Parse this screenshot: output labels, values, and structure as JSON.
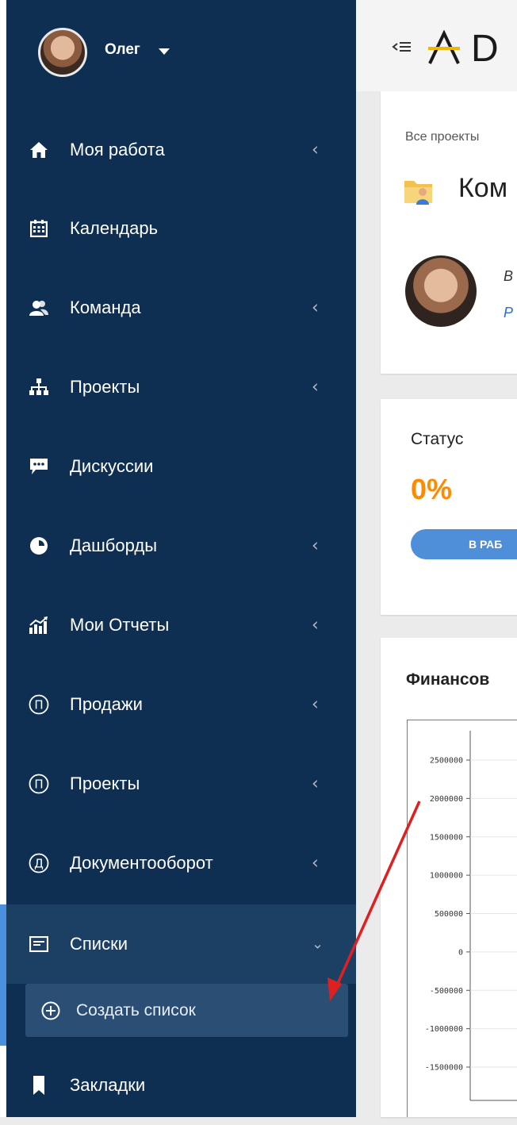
{
  "user": {
    "name": "Олег"
  },
  "sidebar": {
    "items": [
      {
        "label": "Моя работа",
        "icon": "home-icon",
        "has_chevron": true
      },
      {
        "label": "Календарь",
        "icon": "calendar-icon",
        "has_chevron": false
      },
      {
        "label": "Команда",
        "icon": "team-icon",
        "has_chevron": true
      },
      {
        "label": "Проекты",
        "icon": "sitemap-icon",
        "has_chevron": true
      },
      {
        "label": "Дискуссии",
        "icon": "comments-icon",
        "has_chevron": false
      },
      {
        "label": "Дашборды",
        "icon": "pie-chart-icon",
        "has_chevron": true
      },
      {
        "label": "Мои Отчеты",
        "icon": "bar-chart-icon",
        "has_chevron": true
      },
      {
        "label": "Продажи",
        "icon": "circle-letter-icon",
        "letter": "П",
        "has_chevron": true
      },
      {
        "label": "Проекты",
        "icon": "circle-letter-icon",
        "letter": "П",
        "has_chevron": true
      },
      {
        "label": "Документооборот",
        "icon": "circle-letter-icon",
        "letter": "Д",
        "has_chevron": true
      },
      {
        "label": "Списки",
        "icon": "list-icon",
        "has_chevron": true,
        "expanded": true,
        "active": true
      },
      {
        "label": "Закладки",
        "icon": "bookmark-icon",
        "has_chevron": false
      }
    ],
    "sub_item": {
      "label": "Создать список",
      "icon": "plus-circle-icon"
    }
  },
  "header": {
    "logo_letter": "D"
  },
  "project": {
    "breadcrumb": "Все проекты",
    "title": "Ком",
    "pm_line1": "В",
    "pm_line2": "Р"
  },
  "status": {
    "label": "Статус",
    "percent": "0%",
    "pill": "В РАБ"
  },
  "finance": {
    "title": "Финансов"
  },
  "chart_data": {
    "type": "line",
    "y_ticks": [
      "2500000",
      "2000000",
      "1500000",
      "1000000",
      "500000",
      "0",
      "-500000",
      "-1000000",
      "-1500000"
    ],
    "ylim": [
      -1500000,
      2500000
    ]
  },
  "colors": {
    "sidebar_bg": "#0e2f52",
    "active_item_bg": "#1c3f64",
    "accent_bar": "#4b90de",
    "status_percent": "#ff8a00",
    "status_pill": "#4f8fd9",
    "annotation_arrow": "#e02020"
  }
}
